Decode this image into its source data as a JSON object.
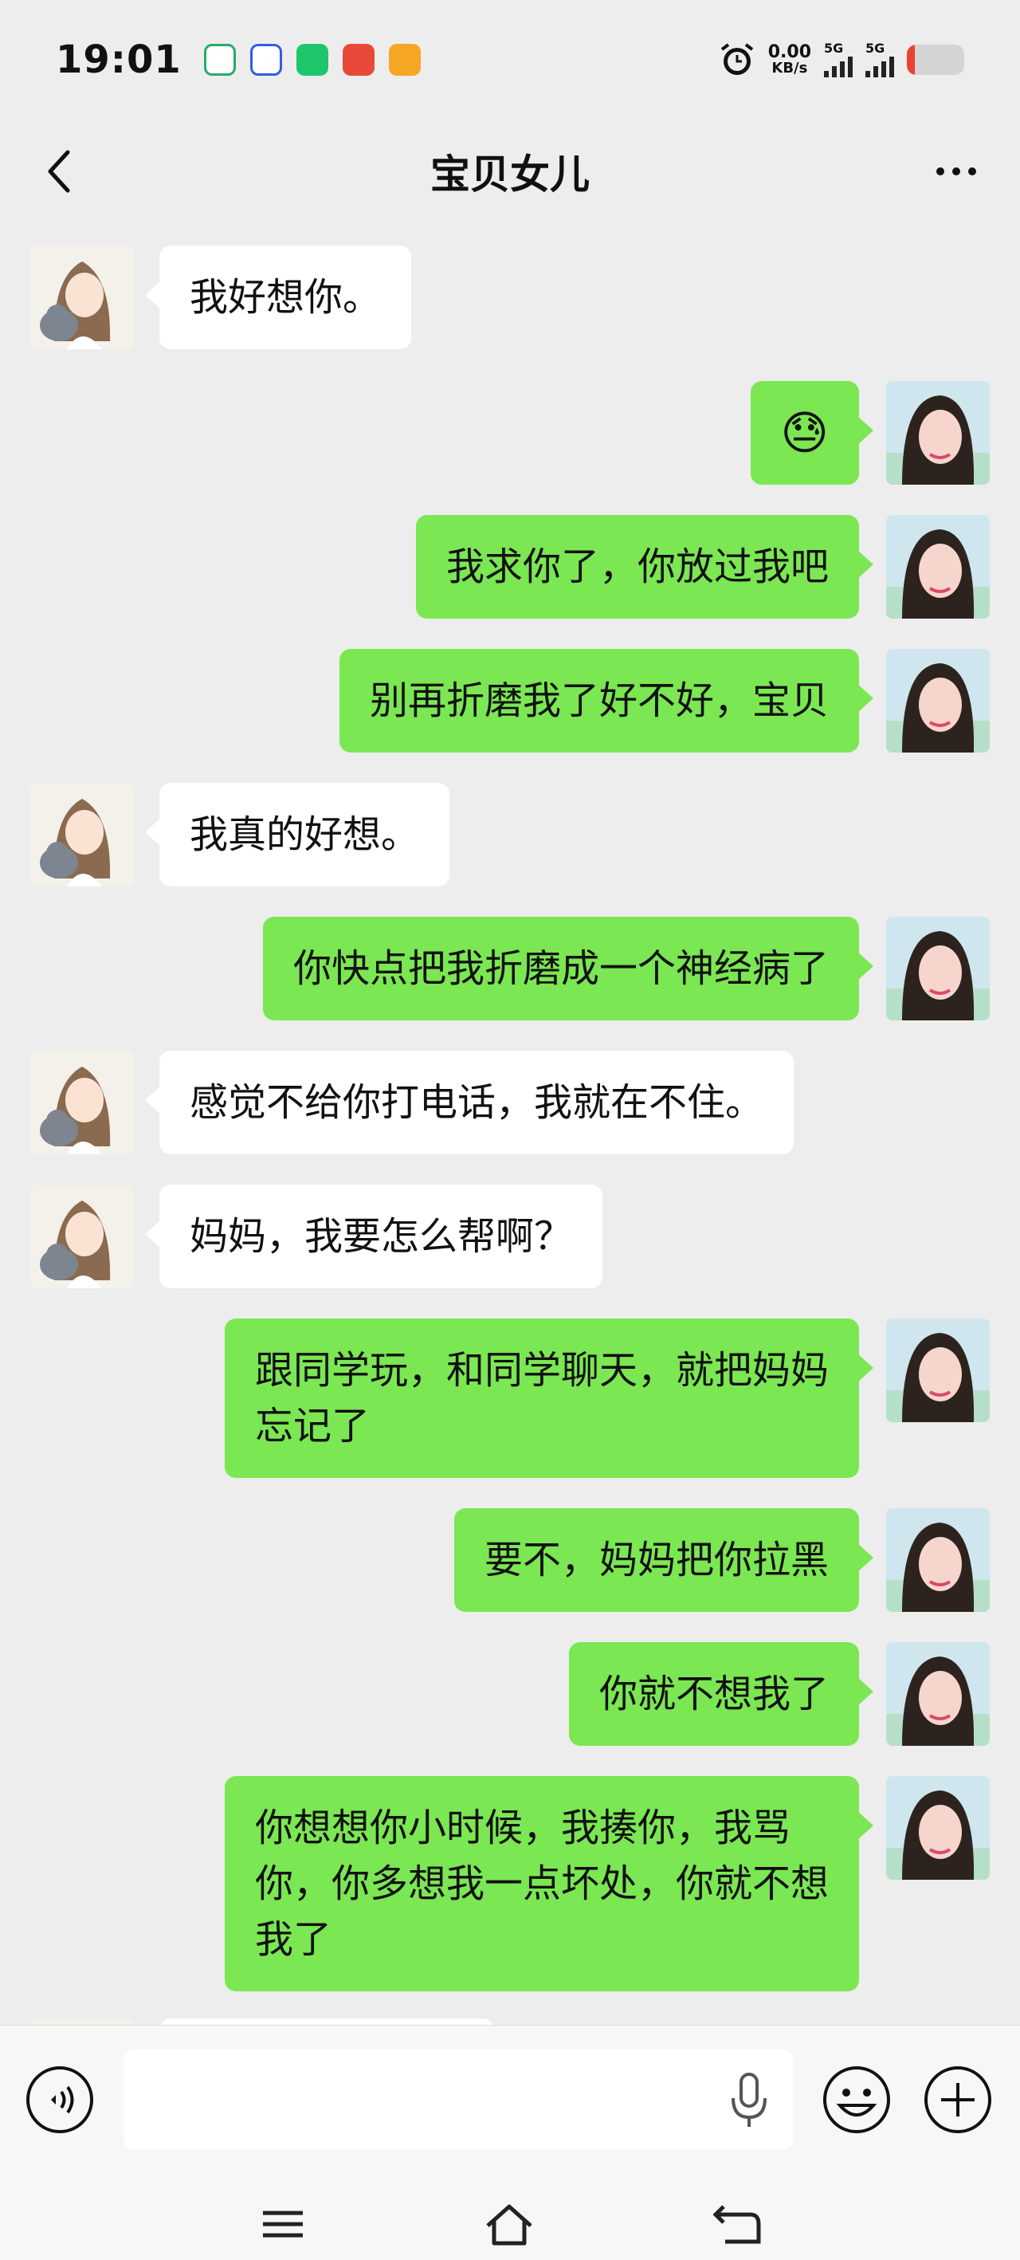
{
  "status_bar": {
    "time": "19:01",
    "net_speed_value": "0.00",
    "net_speed_unit": "KB/s",
    "sim1": "5G",
    "sim2": "5G",
    "battery_level": 0.14
  },
  "header": {
    "title": "宝贝女儿"
  },
  "messages": [
    {
      "side": "in",
      "text": "我好想你。"
    },
    {
      "side": "out",
      "emoji": "😓"
    },
    {
      "side": "out",
      "text": "我求你了，你放过我吧"
    },
    {
      "side": "out",
      "text": "别再折磨我了好不好，宝贝"
    },
    {
      "side": "in",
      "text": "我真的好想。"
    },
    {
      "side": "out",
      "text": "你快点把我折磨成一个神经病了"
    },
    {
      "side": "in",
      "text": "感觉不给你打电话，我就在不住。"
    },
    {
      "side": "in",
      "text": "妈妈，我要怎么帮啊？"
    },
    {
      "side": "out",
      "text": "跟同学玩，和同学聊天，就把妈妈\n忘记了"
    },
    {
      "side": "out",
      "text": "要不，妈妈把你拉黑"
    },
    {
      "side": "out",
      "text": "你就不想我了"
    },
    {
      "side": "out",
      "text": "你想想你小时候，我揍你，我骂\n你，你多想我一点坏处，你就不想\n我了"
    }
  ],
  "colors": {
    "bubble_out": "#7be753",
    "bubble_in": "#ffffff",
    "background": "#ededed"
  }
}
